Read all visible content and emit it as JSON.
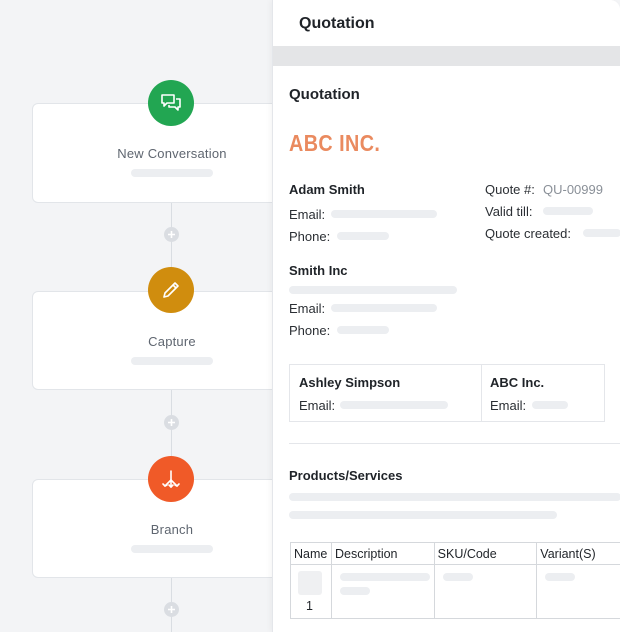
{
  "workflow": {
    "nodes": [
      {
        "label": "New Conversation",
        "icon": "chat-icon",
        "color": "#22a652"
      },
      {
        "label": "Capture",
        "icon": "pencil-icon",
        "color": "#d08d0e"
      },
      {
        "label": "Branch",
        "icon": "branch-icon",
        "color": "#f05a28"
      }
    ]
  },
  "panel": {
    "header_title": "Quotation",
    "doc_title": "Quotation",
    "company_logo": "ABC INC.",
    "logo_color": "#ea8a5f",
    "contact": {
      "name": "Adam Smith",
      "email_label": "Email:",
      "phone_label": "Phone:"
    },
    "quote": {
      "number_label": "Quote #:",
      "number_value": "QU-00999",
      "valid_label": "Valid till:",
      "created_label": "Quote created:"
    },
    "customer": {
      "name": "Smith Inc",
      "email_label": "Email:",
      "phone_label": "Phone:"
    },
    "parties": [
      {
        "name": "Ashley Simpson",
        "email_label": "Email:"
      },
      {
        "name": "ABC Inc.",
        "email_label": "Email:"
      }
    ],
    "products": {
      "section_title": "Products/Services",
      "columns": [
        "Name",
        "Description",
        "SKU/Code",
        "Variant(S)"
      ],
      "rows": [
        {
          "index": "1"
        }
      ]
    }
  }
}
